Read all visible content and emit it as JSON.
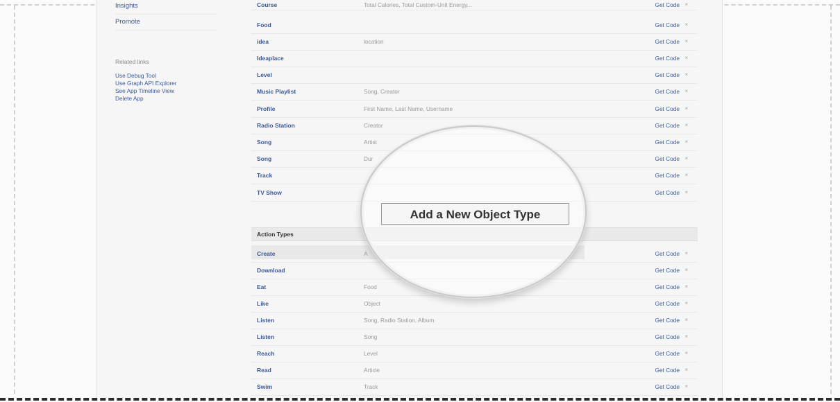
{
  "sidebar": {
    "links": [
      "Insights",
      "Promote"
    ],
    "related_heading": "Related links",
    "related_links": [
      "Use Debug Tool",
      "Use Graph API Explorer",
      "See App Timeline View",
      "Delete App"
    ]
  },
  "object_types": [
    {
      "name": "Course",
      "props": "Total Calories, Total Custom-Unit Energy...",
      "code": "Get Code",
      "remove": "×"
    },
    {
      "name": "Food",
      "props": "",
      "code": "Get Code",
      "remove": "×"
    },
    {
      "name": "idea",
      "props": "location",
      "code": "Get Code",
      "remove": "×"
    },
    {
      "name": "Ideaplace",
      "props": "",
      "code": "Get Code",
      "remove": "×"
    },
    {
      "name": "Level",
      "props": "",
      "code": "Get Code",
      "remove": "×"
    },
    {
      "name": "Music Playlist",
      "props": "Song, Creator",
      "code": "Get Code",
      "remove": "×"
    },
    {
      "name": "Profile",
      "props": "First Name, Last Name, Username",
      "code": "Get Code",
      "remove": "×"
    },
    {
      "name": "Radio Station",
      "props": "Creator",
      "code": "Get Code",
      "remove": "×"
    },
    {
      "name": "Song",
      "props": "Artist",
      "code": "Get Code",
      "remove": "×"
    },
    {
      "name": "Song",
      "props": "Dur",
      "code": "Get Code",
      "remove": "×"
    },
    {
      "name": "Track",
      "props": "",
      "code": "Get Code",
      "remove": "×"
    },
    {
      "name": "TV Show",
      "props": "",
      "code": "Get Code",
      "remove": "×"
    }
  ],
  "add_object_type_label": "Add a New Object Type",
  "action_types_heading": "Action Types",
  "action_types": [
    {
      "name": "Create",
      "props": "A",
      "code": "Get Code",
      "remove": "×"
    },
    {
      "name": "Download",
      "props": "",
      "code": "Get Code",
      "remove": "×"
    },
    {
      "name": "Eat",
      "props": "Food",
      "code": "Get Code",
      "remove": "×"
    },
    {
      "name": "Like",
      "props": "Object",
      "code": "Get Code",
      "remove": "×"
    },
    {
      "name": "Listen",
      "props": "Song, Radio Station, Album",
      "code": "Get Code",
      "remove": "×"
    },
    {
      "name": "Listen",
      "props": "Song",
      "code": "Get Code",
      "remove": "×"
    },
    {
      "name": "Reach",
      "props": "Level",
      "code": "Get Code",
      "remove": "×"
    },
    {
      "name": "Read",
      "props": "Article",
      "code": "Get Code",
      "remove": "×"
    },
    {
      "name": "Swim",
      "props": "Track",
      "code": "Get Code",
      "remove": "×"
    }
  ]
}
